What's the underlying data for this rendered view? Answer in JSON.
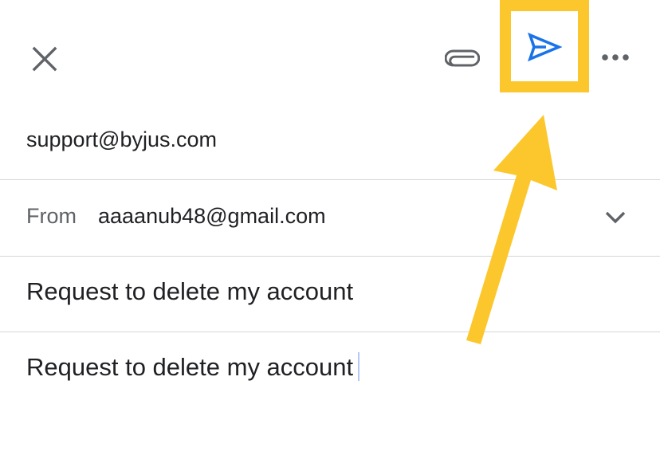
{
  "toolbar": {
    "close_icon": "close-icon",
    "attach_icon": "paperclip-icon",
    "send_icon": "send-icon",
    "more_icon": "more-horizontal-icon"
  },
  "compose": {
    "to": "support@byjus.com",
    "from_label": "From",
    "from_value": "aaaanub48@gmail.com",
    "subject": "Request to delete my account",
    "body": "Request to delete my account"
  },
  "annotation": {
    "highlight_color": "#fcc72c",
    "target": "send-button"
  },
  "colors": {
    "send_icon": "#1a73e8",
    "icon_gray": "#5f6368",
    "divider": "#d6d6d6",
    "caret": "#b6c6f5"
  }
}
